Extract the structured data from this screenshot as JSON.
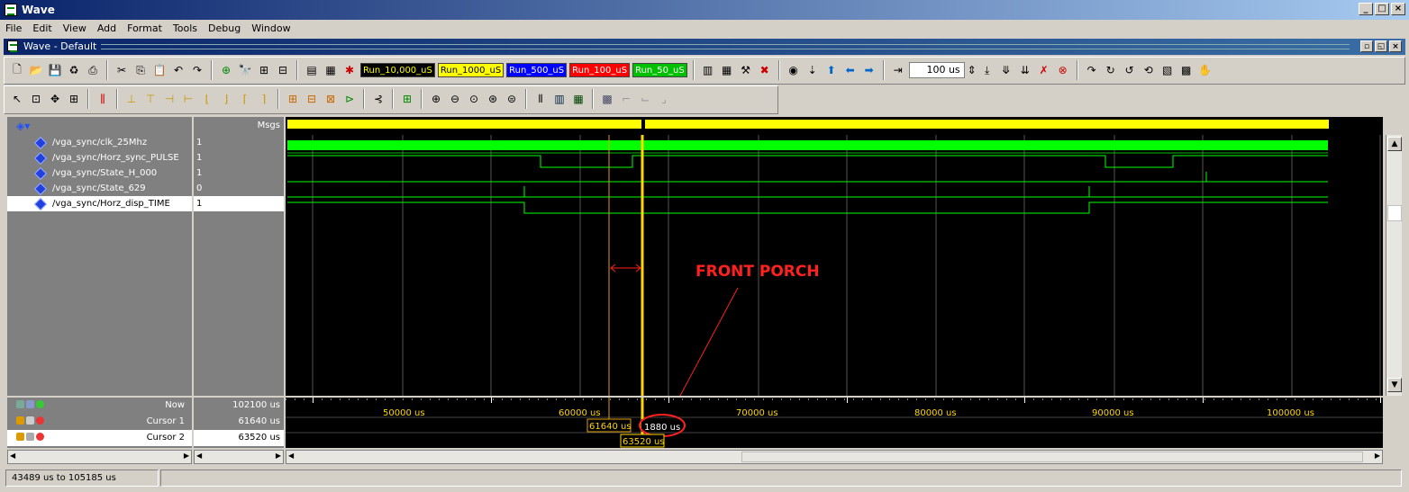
{
  "window": {
    "title": "Wave"
  },
  "menu": [
    "File",
    "Edit",
    "View",
    "Add",
    "Format",
    "Tools",
    "Debug",
    "Window"
  ],
  "subwindow": {
    "title": "Wave - Default"
  },
  "toolbar": {
    "run_buttons": [
      {
        "label": "Run_10,000_uS",
        "bg": "#000000",
        "fg": "#ffff00"
      },
      {
        "label": "Run_1000_uS",
        "bg": "#ffff00",
        "fg": "#000000"
      },
      {
        "label": "Run_500_uS",
        "bg": "#0000ff",
        "fg": "#ffffff"
      },
      {
        "label": "Run_100_uS",
        "bg": "#ff0000",
        "fg": "#ffffff"
      },
      {
        "label": "Run_50_uS",
        "bg": "#00c000",
        "fg": "#ffffff"
      }
    ],
    "run_length": "100 us"
  },
  "header": {
    "msgs_label": "Msgs"
  },
  "signals": [
    {
      "name": "/vga_sync/clk_25Mhz",
      "value": "1"
    },
    {
      "name": "/vga_sync/Horz_sync_PULSE",
      "value": "1"
    },
    {
      "name": "/vga_sync/State_H_000",
      "value": "1"
    },
    {
      "name": "/vga_sync/State_629",
      "value": "0"
    },
    {
      "name": "/vga_sync/Horz_disp_TIME",
      "value": "1",
      "selected": true
    }
  ],
  "cursor_pane": {
    "now_label": "Now",
    "now_value": "102100 us",
    "cursors": [
      {
        "label": "Cursor 1",
        "value": "61640 us"
      },
      {
        "label": "Cursor 2",
        "value": "63520 us",
        "selected": true
      }
    ]
  },
  "timeline": {
    "ticks": [
      "50000 us",
      "60000 us",
      "70000 us",
      "80000 us",
      "90000 us",
      "100000 us"
    ],
    "cursor1_tag": "61640 us",
    "cursor2_tag": "63520 us",
    "delta_tag": "1880 us"
  },
  "annotation": {
    "label": "FRONT PORCH",
    "color": "#ff0000"
  },
  "status": {
    "range": "43489 us to 105185 us"
  },
  "colors": {
    "wave_green": "#00ff00",
    "cursor_yellow": "#ffd700",
    "header_yellow": "#ffff00"
  }
}
